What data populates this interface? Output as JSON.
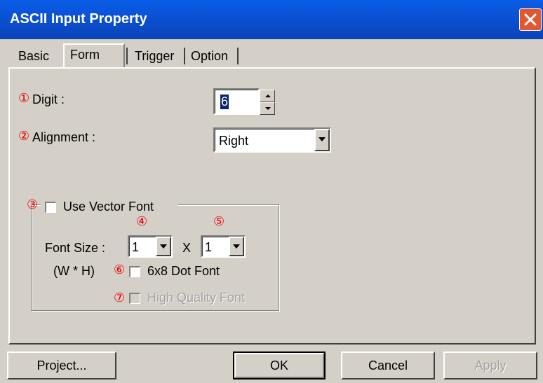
{
  "window": {
    "title": "ASCII Input Property"
  },
  "tabs": [
    "Basic",
    "Form",
    "Trigger",
    "Option"
  ],
  "active_tab": "Form",
  "form": {
    "digit": {
      "marker": "①",
      "label": "Digit :",
      "value": "6"
    },
    "alignment": {
      "marker": "②",
      "label": "Alignment :",
      "value": "Right"
    },
    "vector_font": {
      "marker": "③",
      "label": "Use Vector Font",
      "checked": false
    },
    "font_size": {
      "label": "Font Size :",
      "width_marker": "④",
      "height_marker": "⑤",
      "width": "1",
      "separator": "X",
      "height": "1"
    },
    "wh_label": "(W * H)",
    "dot_font": {
      "marker": "⑥",
      "label": "6x8 Dot Font",
      "checked": false
    },
    "hq_font": {
      "marker": "⑦",
      "label": "High Quality Font",
      "checked": false,
      "enabled": false
    }
  },
  "buttons": {
    "project": "Project...",
    "ok": "OK",
    "cancel": "Cancel",
    "apply": "Apply"
  },
  "colors": {
    "titlebar": "#0b52d6",
    "marker": "#e00000",
    "close": "#e2572f"
  }
}
